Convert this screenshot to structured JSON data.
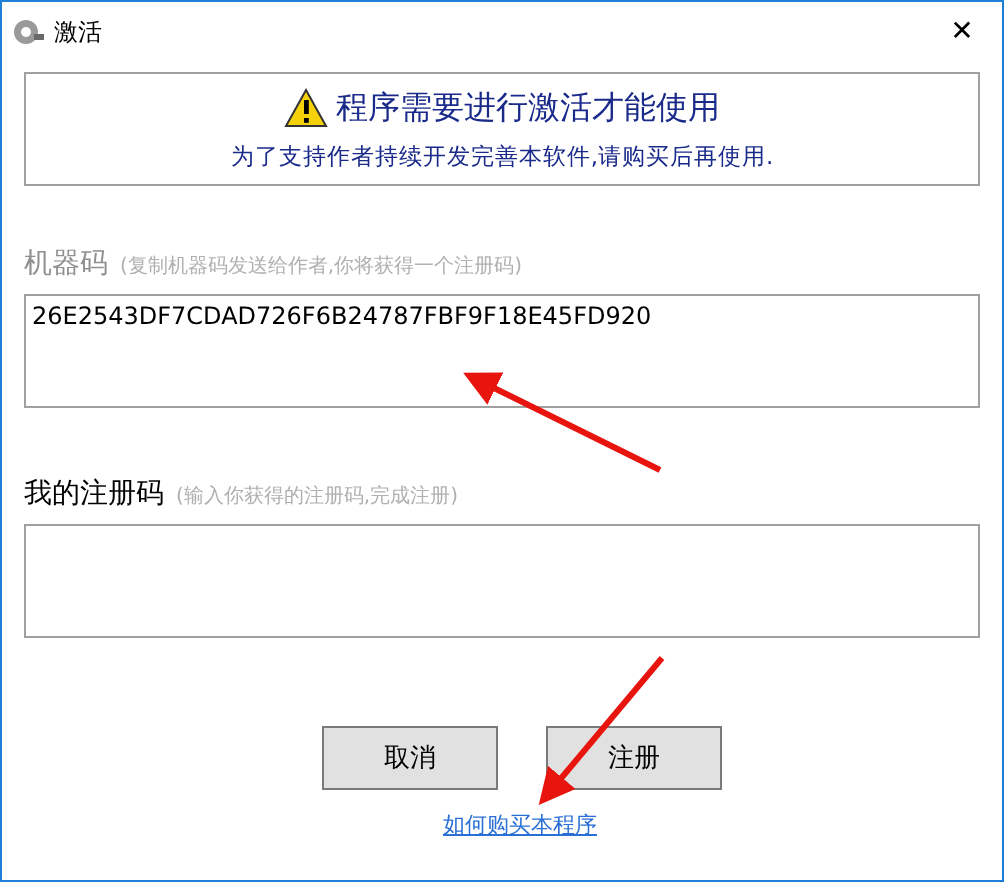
{
  "window": {
    "title": "激活",
    "close": "✕"
  },
  "notice": {
    "heading": "程序需要进行激活才能使用",
    "message": "为了支持作者持续开发完善本软件,请购买后再使用."
  },
  "machine_code": {
    "label": "机器码",
    "hint": "(复制机器码发送给作者,你将获得一个注册码)",
    "value": "26E2543DF7CDAD726F6B24787FBF9F18E45FD920"
  },
  "registration_code": {
    "label": "我的注册码",
    "hint": "(输入你获得的注册码,完成注册)"
  },
  "buttons": [
    {
      "label": "取消"
    },
    {
      "label": "注册"
    }
  ],
  "link": "如何购买本程序"
}
